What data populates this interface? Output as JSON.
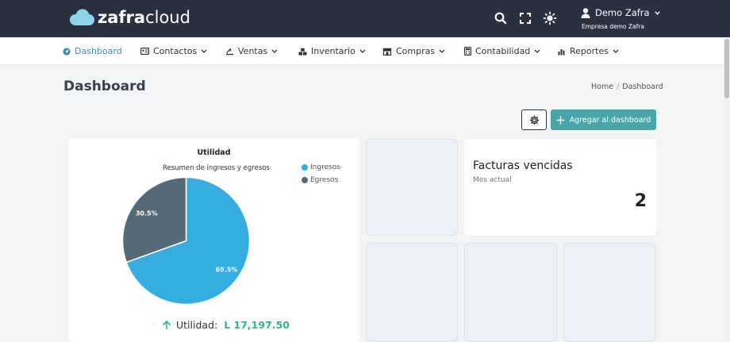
{
  "topbar": {
    "logo_bold": "zafra",
    "logo_light": "cloud",
    "icons": [
      "search-icon",
      "fullscreen-icon",
      "theme-sun-icon"
    ],
    "user": {
      "name": "Demo Zafra",
      "company": "Empresa demo Zafra"
    }
  },
  "nav": {
    "items": [
      {
        "label": "Dashboard",
        "icon": "dashboard-icon",
        "active": true
      },
      {
        "label": "Contactos",
        "icon": "contacts-icon",
        "dropdown": true
      },
      {
        "label": "Ventas",
        "icon": "sales-icon",
        "dropdown": true
      },
      {
        "label": "Inventario",
        "icon": "inventory-icon",
        "dropdown": true
      },
      {
        "label": "Compras",
        "icon": "store-icon",
        "dropdown": true
      },
      {
        "label": "Contabilidad",
        "icon": "accounting-icon",
        "dropdown": true
      },
      {
        "label": "Reportes",
        "icon": "reports-icon",
        "dropdown": true
      }
    ]
  },
  "page": {
    "title": "Dashboard",
    "breadcrumb": [
      "Home",
      "Dashboard"
    ]
  },
  "actions": {
    "add_label": "Agregar al dashboard"
  },
  "utilidad_card": {
    "utilidad_label": "Utilidad:",
    "utilidad_value": "L 17,197.50"
  },
  "facturas_card": {
    "title": "Facturas vencidas",
    "subtitle": "Mes actual",
    "value": "2"
  },
  "colors": {
    "topbar": "#2b3040",
    "accent": "#4ba5a8",
    "ingresos": "#35ade0",
    "egresos": "#546a78",
    "positive": "#2fba79"
  },
  "chart_data": {
    "type": "pie",
    "title": "Utilidad",
    "subtitle": "Resumen de ingresos y egresos",
    "series": [
      {
        "name": "Ingresos",
        "value": 69.5,
        "label": "69.5%",
        "color": "#35ade0"
      },
      {
        "name": "Egresos",
        "value": 30.5,
        "label": "30.5%",
        "color": "#546a78"
      }
    ],
    "legend": "top-right"
  }
}
